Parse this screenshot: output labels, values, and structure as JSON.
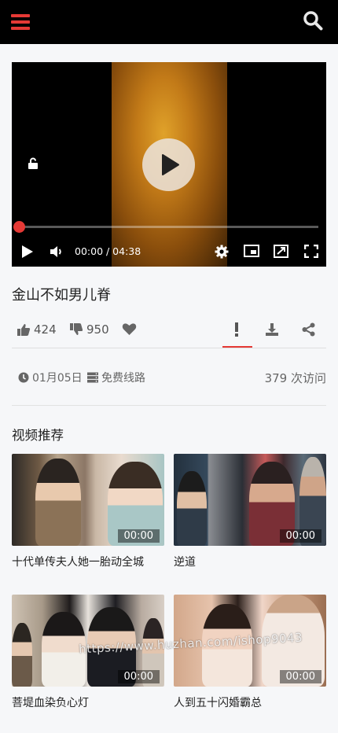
{
  "video": {
    "time_display": "00:00 / 04:38",
    "progress": 0,
    "title": "金山不如男儿脊"
  },
  "actions": {
    "likes": "424",
    "dislikes": "950"
  },
  "meta": {
    "date": "01月05日",
    "line": "免费线路",
    "views": "379 次访问"
  },
  "recommend": {
    "heading": "视频推荐",
    "items": [
      {
        "title": "十代单传夫人她一胎动全城",
        "duration": "00:00"
      },
      {
        "title": "逆道",
        "duration": "00:00"
      },
      {
        "title": "菩堤血染负心灯",
        "duration": "00:00"
      },
      {
        "title": "人到五十闪婚霸总",
        "duration": "00:00"
      }
    ]
  },
  "watermark": "https://www.huzhan.com/ishop9043",
  "icons": {
    "menu": "hamburger-icon",
    "search": "search-icon",
    "play": "play-icon",
    "lock": "unlock-icon",
    "volume": "volume-icon",
    "settings": "gear-icon",
    "pip": "picture-in-picture-icon",
    "theater": "theater-mode-icon",
    "fullscreen": "fullscreen-icon",
    "like": "thumbs-up-icon",
    "dislike": "thumbs-down-icon",
    "favorite": "heart-icon",
    "report": "exclamation-icon",
    "download": "download-icon",
    "share": "share-icon",
    "clock": "clock-icon",
    "server": "server-icon"
  },
  "colors": {
    "accent": "#e53935",
    "topbar": "#000000",
    "background": "#f6f7f9"
  }
}
